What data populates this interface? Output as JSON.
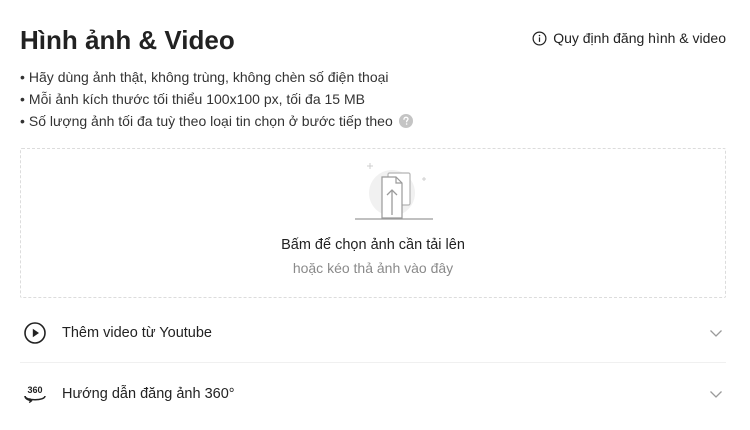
{
  "header": {
    "title": "Hình ảnh & Video",
    "rules_link": "Quy định đăng hình & video"
  },
  "bullets": [
    "Hãy dùng ảnh thật, không trùng, không chèn số điện thoại",
    "Mỗi ảnh kích thước tối thiểu 100x100 px, tối đa 15 MB",
    "Số lượng ảnh tối đa tuỳ theo loại tin chọn ở bước tiếp theo"
  ],
  "bullet_marker": "•",
  "dropzone": {
    "primary": "Bấm để chọn ảnh cần tải lên",
    "secondary": "hoặc kéo thả ảnh vào đây"
  },
  "options": [
    {
      "label": "Thêm video từ Youtube",
      "icon": "play-circle-icon"
    },
    {
      "label": "Hướng dẫn đăng ảnh 360°",
      "icon": "rotate-360-icon",
      "icon_text": "360"
    }
  ],
  "colors": {
    "text": "#222222",
    "muted": "#8a8a8a",
    "border": "#dcdcdc",
    "icon_gray": "#b5b5b5"
  }
}
